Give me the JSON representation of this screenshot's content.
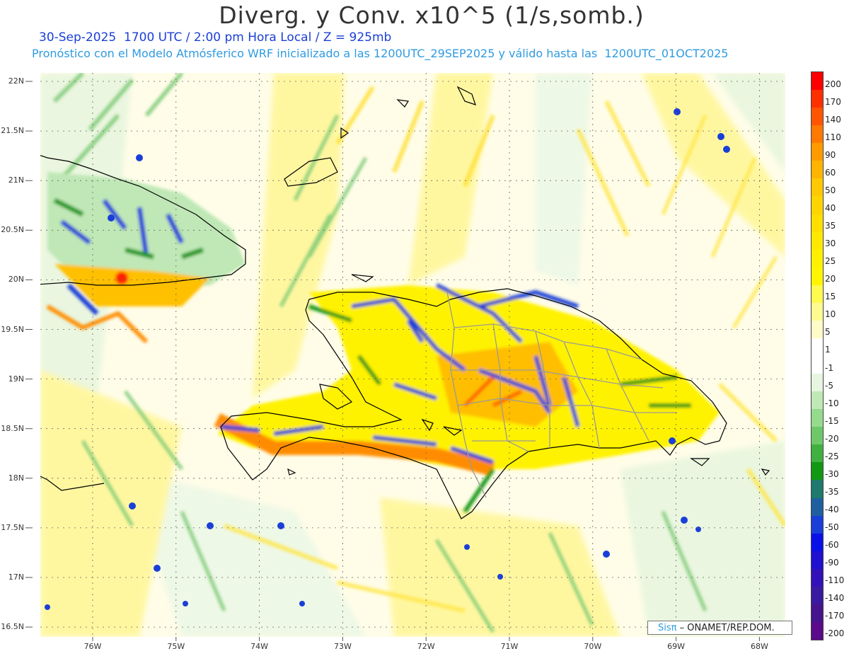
{
  "header": {
    "title": "Diverg. y Conv. x10^5 (1/s,somb.)",
    "valid_line": "30-Sep-2025  1700 UTC / 2:00 pm Hora Local / Z = 925mb",
    "model_line": "Pronóstico con el Modelo Atmósferico WRF inicializado a las 1200UTC_29SEP2025 y válido hasta las  1200UTC_01OCT2025"
  },
  "axes": {
    "lat_labels": [
      "22N",
      "21.5N",
      "21N",
      "20.5N",
      "20N",
      "19.5N",
      "19N",
      "18.5N",
      "18N",
      "17.5N",
      "17N",
      "16.5N"
    ],
    "lon_labels": [
      "76W",
      "75W",
      "74W",
      "73W",
      "72W",
      "71W",
      "70W",
      "69W",
      "68W"
    ]
  },
  "colorbar": {
    "labels": [
      "200",
      "170",
      "140",
      "110",
      "90",
      "60",
      "50",
      "40",
      "35",
      "30",
      "25",
      "20",
      "15",
      "10",
      "5",
      "1",
      "-1",
      "-5",
      "-10",
      "-15",
      "-20",
      "-25",
      "-30",
      "-35",
      "-40",
      "-50",
      "-60",
      "-90",
      "-110",
      "-140",
      "-170",
      "-200"
    ],
    "colors": [
      "#ff0000",
      "#ff3000",
      "#ff5500",
      "#ff7800",
      "#ff9a00",
      "#ffb400",
      "#ffc800",
      "#ffd400",
      "#ffde00",
      "#ffe800",
      "#fff000",
      "#fff500",
      "#fffa50",
      "#fffb90",
      "#fffcc8",
      "#ffffff",
      "#ffffff",
      "#e6f6e0",
      "#bfe8b6",
      "#96da8e",
      "#6ec86a",
      "#40b040",
      "#129812",
      "#1d7a6d",
      "#1f5fa0",
      "#1a3fd8",
      "#0a10e8",
      "#2010d0",
      "#3212b8",
      "#3a1aa0",
      "#46148c",
      "#5a0a8a"
    ]
  },
  "credit": {
    "brand": "Sisπ",
    "text": " – ONAMET/REP.DOM."
  }
}
